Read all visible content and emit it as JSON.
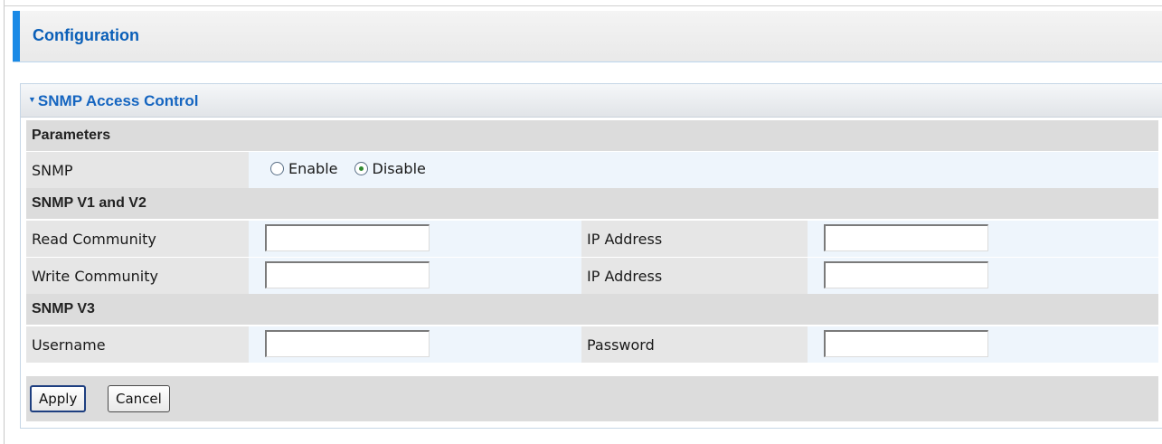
{
  "header": {
    "title": "Configuration"
  },
  "panel": {
    "title": "SNMP Access Control"
  },
  "sections": {
    "parameters": "Parameters",
    "v1v2": "SNMP V1 and V2",
    "v3": "SNMP V3"
  },
  "snmp": {
    "label": "SNMP",
    "options": [
      {
        "label": "Enable",
        "checked": false
      },
      {
        "label": "Disable",
        "checked": true
      }
    ]
  },
  "fields": {
    "read_community": {
      "label": "Read Community",
      "value": ""
    },
    "read_ip": {
      "label": "IP Address",
      "value": ""
    },
    "write_community": {
      "label": "Write Community",
      "value": ""
    },
    "write_ip": {
      "label": "IP Address",
      "value": ""
    },
    "username": {
      "label": "Username",
      "value": ""
    },
    "password": {
      "label": "Password",
      "value": ""
    }
  },
  "buttons": {
    "apply": "Apply",
    "cancel": "Cancel"
  },
  "colors": {
    "accent": "#1a8ae6",
    "title": "#0a5fb8",
    "panel_title": "#1565c0"
  }
}
